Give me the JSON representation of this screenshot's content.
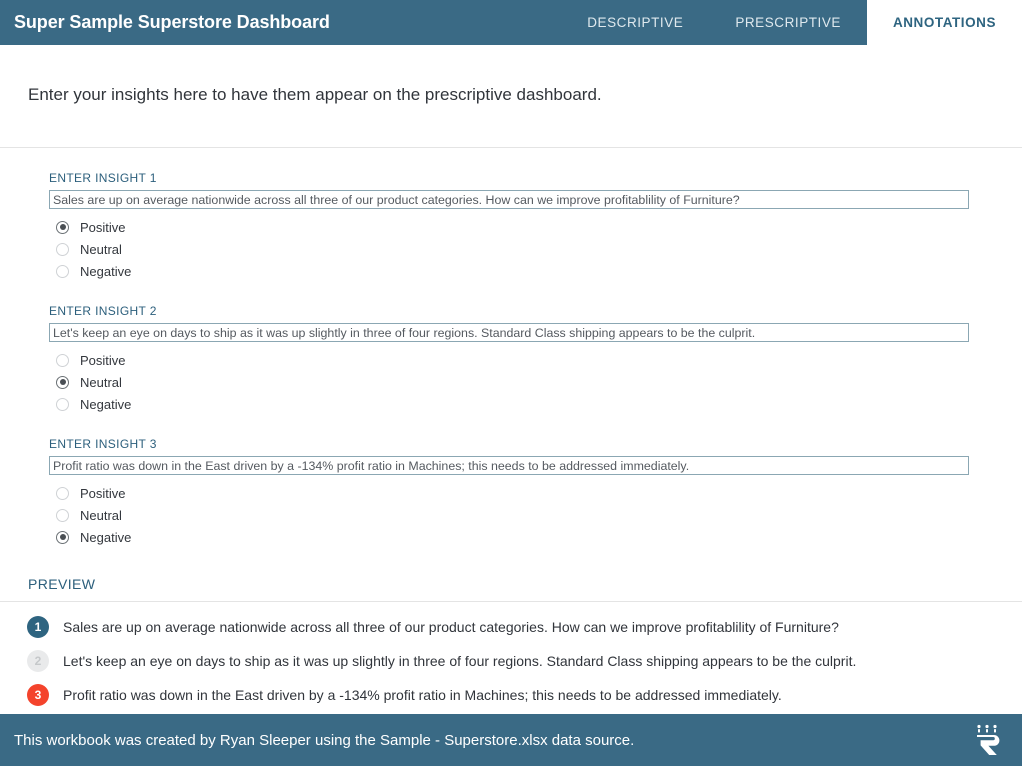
{
  "header": {
    "title": "Super Sample Superstore Dashboard",
    "tabs": [
      {
        "label": "DESCRIPTIVE",
        "active": false
      },
      {
        "label": "PRESCRIPTIVE",
        "active": false
      },
      {
        "label": "ANNOTATIONS",
        "active": true
      }
    ],
    "background_color": "#3a6a85",
    "active_tab_color": "#2e6480"
  },
  "subtitle": "Enter your insights here to have them appear on the prescriptive dashboard.",
  "insights": [
    {
      "label": "ENTER INSIGHT 1",
      "value": "Sales are up on average nationwide across all three of our product categories. How can we improve profitablility of Furniture?",
      "placeholder": "",
      "sentiment": "Positive",
      "options": [
        "Positive",
        "Neutral",
        "Negative"
      ]
    },
    {
      "label": "ENTER INSIGHT 2",
      "value": "Let's keep an eye on days to ship as it was up slightly in three of four regions. Standard Class shipping appears to be the culprit.",
      "placeholder": "",
      "sentiment": "Neutral",
      "options": [
        "Positive",
        "Neutral",
        "Negative"
      ]
    },
    {
      "label": "ENTER INSIGHT 3",
      "value": "Profit ratio was down in the East driven by a -134% profit ratio in Machines; this needs to be addressed immediately.",
      "placeholder": "",
      "sentiment": "Negative",
      "options": [
        "Positive",
        "Neutral",
        "Negative"
      ]
    }
  ],
  "preview": {
    "heading": "PREVIEW",
    "rows": [
      {
        "number": "1",
        "text": "Sales are up on average nationwide across all three of our product categories. How can we improve profitablility of Furniture?",
        "badge_color": "#2e6480",
        "badge_text_color": "#ffffff"
      },
      {
        "number": "2",
        "text": "Let's keep an eye on days to ship as it was up slightly in three of four regions. Standard Class shipping appears to be the culprit.",
        "badge_color": "#e9eaeb",
        "badge_text_color": "#c5c8ca"
      },
      {
        "number": "3",
        "text": "Profit ratio was down in the East driven by a -134% profit ratio in Machines; this needs to be addressed immediately.",
        "badge_color": "#f4432c",
        "badge_text_color": "#ffffff"
      }
    ]
  },
  "footer": {
    "text": "This workbook was created by Ryan Sleeper using the Sample - Superstore.xlsx data source.",
    "logo": "ryan-sleeper-r-logo"
  }
}
